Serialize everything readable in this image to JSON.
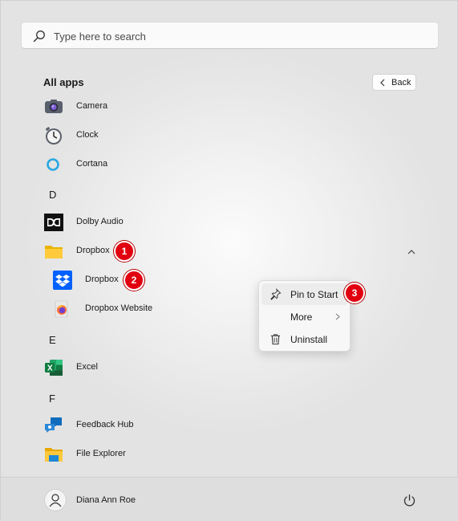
{
  "search": {
    "placeholder": "Type here to search",
    "icon": "search-icon"
  },
  "header": {
    "title": "All apps",
    "back_label": "Back"
  },
  "apps": {
    "camera": {
      "label": "Camera",
      "icon": "camera-icon"
    },
    "clock": {
      "label": "Clock",
      "icon": "clock-icon"
    },
    "cortana": {
      "label": "Cortana",
      "icon": "cortana-icon"
    },
    "letter_d": "D",
    "dolby": {
      "label": "Dolby Audio",
      "icon": "dolby-icon"
    },
    "dropbox_folder": {
      "label": "Dropbox",
      "icon": "folder-icon"
    },
    "dropbox": {
      "label": "Dropbox",
      "icon": "dropbox-icon"
    },
    "dropbox_website": {
      "label": "Dropbox Website",
      "icon": "firefox-icon"
    },
    "letter_e": "E",
    "excel": {
      "label": "Excel",
      "icon": "excel-icon"
    },
    "letter_f": "F",
    "feedback": {
      "label": "Feedback Hub",
      "icon": "feedback-hub-icon"
    },
    "file_explorer": {
      "label": "File Explorer",
      "icon": "file-explorer-icon"
    }
  },
  "context_menu": {
    "pin": {
      "label": "Pin to Start",
      "icon": "pin-icon"
    },
    "more": {
      "label": "More",
      "icon": "chevron-right-icon"
    },
    "uninstall": {
      "label": "Uninstall",
      "icon": "trash-icon"
    }
  },
  "badges": {
    "one": "1",
    "two": "2",
    "three": "3"
  },
  "footer": {
    "user_name": "Diana Ann Roe",
    "power_icon": "power-icon"
  },
  "colors": {
    "badge": "#e1000f",
    "dropbox_blue": "#0061fe",
    "excel_green": "#107c41",
    "cortana": "#2aa8e0"
  }
}
